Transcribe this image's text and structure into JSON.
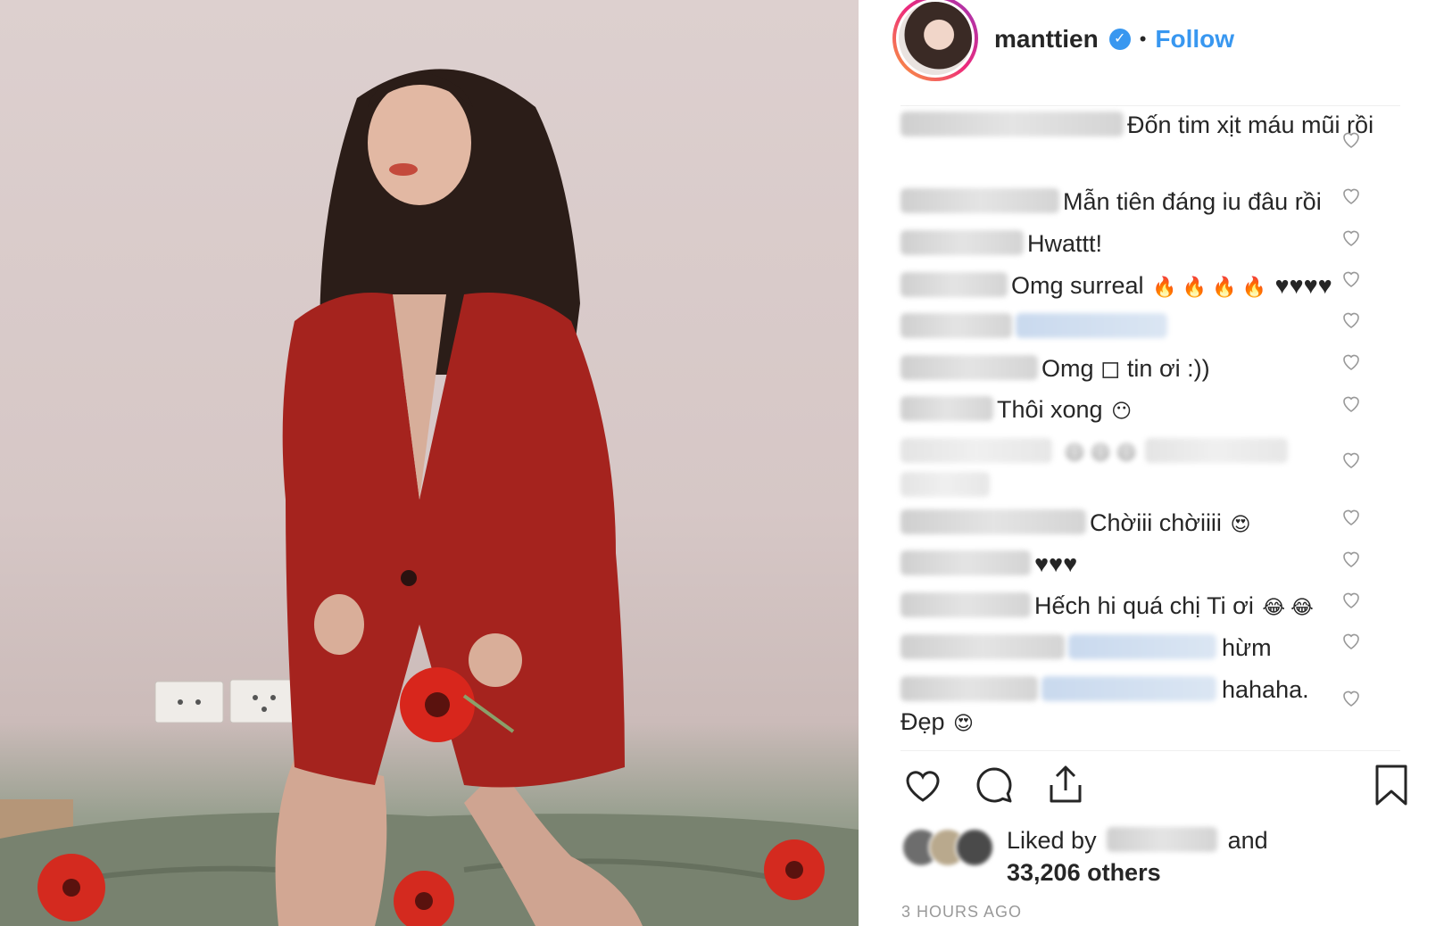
{
  "post": {
    "username": "manttien",
    "verified_icon": "verified-badge-icon",
    "separator": "•",
    "follow_label": "Follow"
  },
  "comments": [
    {
      "text": "Đốn tim xịt máu mũi rồi"
    },
    {
      "text": "Mẫn tiên đáng iu đâu rồi"
    },
    {
      "text": "Hwattt!"
    },
    {
      "text": "Omg surreal",
      "emoji": "🔥 🔥 🔥 🔥",
      "hearts": "♥♥♥♥"
    },
    {
      "text": ""
    },
    {
      "text": "Omg ◻ tin ơi :))"
    },
    {
      "text": "Thôi xong",
      "emoji": "😶"
    },
    {
      "text": "",
      "emoji": "😄 😄 😄"
    },
    {
      "text": "Chờiii chờiiii",
      "emoji": "😍"
    },
    {
      "text": "♥♥♥"
    },
    {
      "text": "Hếch hi quá chị Ti ơi",
      "emoji": "😂 😂"
    },
    {
      "text": "hừm"
    },
    {
      "text": "hahaha.",
      "continuation": "Đẹp",
      "emoji": "😍"
    }
  ],
  "likes": {
    "prefix": "Liked by",
    "and": "and",
    "count": "33,206 others"
  },
  "timestamp": "3 HOURS AGO",
  "colors": {
    "accent": "#3897f0",
    "text": "#262626",
    "muted": "#999999"
  }
}
